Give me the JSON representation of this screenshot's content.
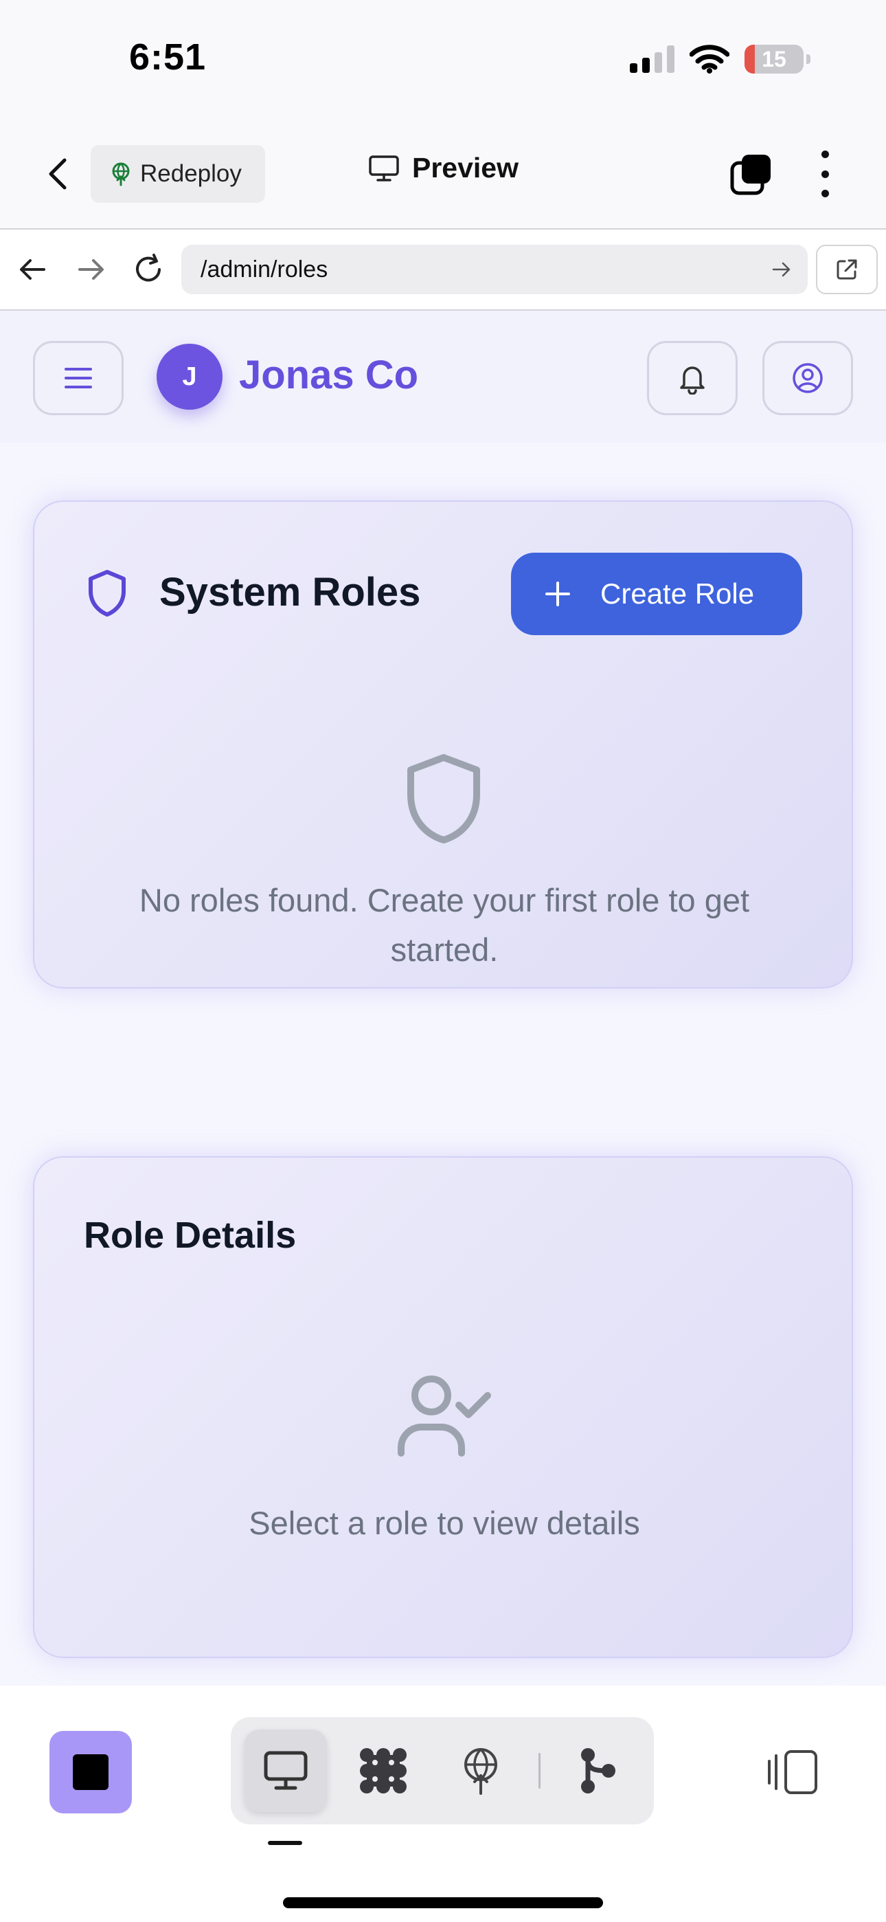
{
  "status_bar": {
    "time": "6:51",
    "battery_level": "15",
    "icons": [
      "signal-icon",
      "wifi-icon",
      "battery-icon"
    ]
  },
  "app_bar": {
    "redeploy_label": "Redeploy",
    "preview_label": "Preview",
    "icons": [
      "back-chevron-icon",
      "globe-upload-icon",
      "monitor-icon",
      "tabs-icon",
      "more-icon"
    ]
  },
  "url_bar": {
    "url": "/admin/roles",
    "icons": [
      "back-arrow-icon",
      "forward-arrow-icon",
      "reload-icon",
      "go-arrow-icon",
      "open-external-icon"
    ]
  },
  "site": {
    "avatar_initial": "J",
    "brand_name": "Jonas Co",
    "icons": [
      "menu-icon",
      "bell-icon",
      "user-circle-icon"
    ]
  },
  "system_roles": {
    "title": "System Roles",
    "create_button_label": "Create Role",
    "empty_message": "No roles found. Create your first role to get started."
  },
  "role_details": {
    "title": "Role Details",
    "empty_message": "Select a role to view details"
  },
  "bottom_toolbar": {
    "modes": [
      "monitor-icon",
      "grid-blob-icon",
      "globe-upload-icon",
      "branch-icon"
    ],
    "active_mode": "monitor-icon"
  },
  "colors": {
    "brand": "#6450dc",
    "primary_button": "#3e63dd",
    "stop_button": "#a997f7",
    "muted_text": "#6b7280",
    "battery_low": "#e5534b"
  }
}
